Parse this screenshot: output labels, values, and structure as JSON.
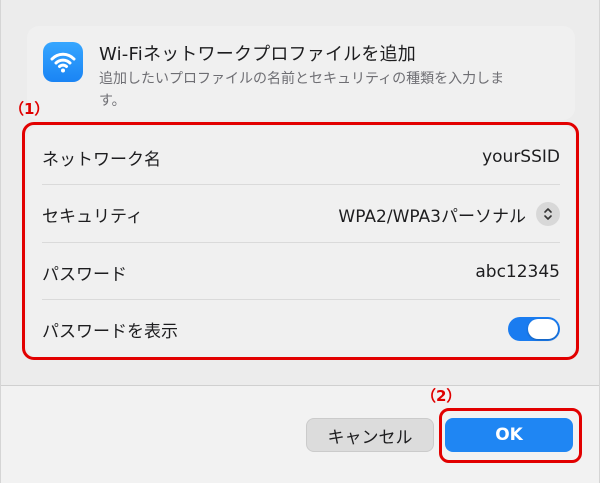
{
  "header": {
    "title": "Wi-Fiネットワークプロファイルを追加",
    "description": "追加したいプロファイルの名前とセキュリティの種類を入力します。"
  },
  "annotations": {
    "form": "（1）",
    "ok": "（2）"
  },
  "form": {
    "network_name": {
      "label": "ネットワーク名",
      "value": "yourSSID"
    },
    "security": {
      "label": "セキュリティ",
      "value": "WPA2/WPA3パーソナル"
    },
    "password": {
      "label": "パスワード",
      "value": "abc12345"
    },
    "show_password": {
      "label": "パスワードを表示",
      "enabled": true
    }
  },
  "buttons": {
    "cancel": "キャンセル",
    "ok": "OK"
  },
  "icons": {
    "app": "wifi-icon",
    "security_select": "chevron-up-down-icon"
  },
  "colors": {
    "accent": "#1f86f3",
    "annotation": "#e20000"
  }
}
